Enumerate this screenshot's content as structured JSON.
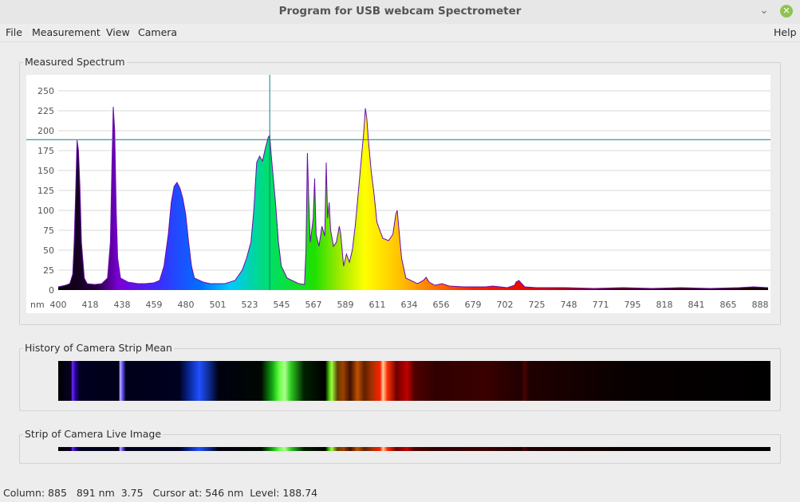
{
  "window": {
    "title": "Program for USB webcam Spectrometer"
  },
  "menu": {
    "file": "File",
    "measurement": "Measurement",
    "view": "View",
    "camera": "Camera",
    "help": "Help"
  },
  "groups": {
    "spectrum": "Measured Spectrum",
    "history": "History of Camera Strip Mean",
    "live": "Strip of Camera Live Image"
  },
  "status": {
    "column": "Column: 885",
    "nm": "891 nm",
    "value": "3.75",
    "cursor": "Cursor at: 546 nm",
    "level": "Level: 188.74"
  },
  "colors": {
    "outline": "#6a0dad",
    "cursor": "#0f7e7e",
    "grid": "#d9d9d9"
  },
  "chart_data": {
    "type": "area",
    "xlabel": "nm",
    "xlim": [
      400,
      890
    ],
    "ylim": [
      0,
      250
    ],
    "x_ticks": [
      "400",
      "418",
      "438",
      "459",
      "480",
      "501",
      "523",
      "545",
      "567",
      "589",
      "611",
      "634",
      "656",
      "679",
      "702",
      "725",
      "748",
      "771",
      "795",
      "818",
      "841",
      "865",
      "888"
    ],
    "y_ticks": [
      0,
      25,
      50,
      75,
      100,
      125,
      150,
      175,
      200,
      225,
      250
    ],
    "cursor_nm": 546,
    "level": 188.74,
    "points": [
      [
        400,
        4
      ],
      [
        405,
        6
      ],
      [
        408,
        8
      ],
      [
        410,
        20
      ],
      [
        411,
        60
      ],
      [
        412,
        120
      ],
      [
        413,
        188
      ],
      [
        414,
        175
      ],
      [
        415,
        130
      ],
      [
        416,
        60
      ],
      [
        418,
        15
      ],
      [
        420,
        8
      ],
      [
        425,
        7
      ],
      [
        430,
        8
      ],
      [
        434,
        15
      ],
      [
        436,
        60
      ],
      [
        437,
        150
      ],
      [
        438,
        230
      ],
      [
        439,
        200
      ],
      [
        440,
        100
      ],
      [
        441,
        40
      ],
      [
        443,
        15
      ],
      [
        448,
        10
      ],
      [
        455,
        8
      ],
      [
        460,
        8
      ],
      [
        466,
        9
      ],
      [
        470,
        12
      ],
      [
        473,
        30
      ],
      [
        476,
        70
      ],
      [
        478,
        110
      ],
      [
        480,
        130
      ],
      [
        482,
        135
      ],
      [
        484,
        128
      ],
      [
        486,
        115
      ],
      [
        488,
        95
      ],
      [
        490,
        60
      ],
      [
        492,
        30
      ],
      [
        494,
        15
      ],
      [
        500,
        10
      ],
      [
        505,
        8
      ],
      [
        515,
        8
      ],
      [
        522,
        12
      ],
      [
        527,
        25
      ],
      [
        530,
        40
      ],
      [
        533,
        60
      ],
      [
        535,
        100
      ],
      [
        537,
        160
      ],
      [
        539,
        168
      ],
      [
        541,
        162
      ],
      [
        543,
        178
      ],
      [
        545,
        192
      ],
      [
        546,
        194
      ],
      [
        547,
        170
      ],
      [
        548,
        150
      ],
      [
        550,
        110
      ],
      [
        552,
        60
      ],
      [
        554,
        30
      ],
      [
        558,
        15
      ],
      [
        566,
        8
      ],
      [
        570,
        7
      ],
      [
        571,
        50
      ],
      [
        572,
        172
      ],
      [
        573,
        110
      ],
      [
        574,
        60
      ],
      [
        576,
        90
      ],
      [
        577,
        140
      ],
      [
        578,
        70
      ],
      [
        580,
        55
      ],
      [
        582,
        80
      ],
      [
        584,
        68
      ],
      [
        585,
        160
      ],
      [
        586,
        90
      ],
      [
        587,
        110
      ],
      [
        588,
        75
      ],
      [
        590,
        55
      ],
      [
        592,
        60
      ],
      [
        594,
        80
      ],
      [
        595,
        70
      ],
      [
        597,
        30
      ],
      [
        599,
        45
      ],
      [
        601,
        35
      ],
      [
        603,
        50
      ],
      [
        605,
        80
      ],
      [
        606,
        100
      ],
      [
        608,
        140
      ],
      [
        610,
        180
      ],
      [
        611,
        200
      ],
      [
        612,
        228
      ],
      [
        613,
        215
      ],
      [
        614,
        190
      ],
      [
        616,
        150
      ],
      [
        618,
        120
      ],
      [
        620,
        85
      ],
      [
        624,
        65
      ],
      [
        628,
        62
      ],
      [
        631,
        70
      ],
      [
        633,
        95
      ],
      [
        634,
        100
      ],
      [
        635,
        80
      ],
      [
        637,
        40
      ],
      [
        640,
        15
      ],
      [
        648,
        8
      ],
      [
        652,
        12
      ],
      [
        654,
        16
      ],
      [
        656,
        10
      ],
      [
        660,
        6
      ],
      [
        665,
        8
      ],
      [
        670,
        5
      ],
      [
        680,
        4
      ],
      [
        695,
        4
      ],
      [
        700,
        5
      ],
      [
        710,
        3
      ],
      [
        715,
        6
      ],
      [
        716,
        10
      ],
      [
        718,
        12
      ],
      [
        720,
        8
      ],
      [
        722,
        4
      ],
      [
        730,
        3
      ],
      [
        750,
        3
      ],
      [
        770,
        2
      ],
      [
        790,
        3
      ],
      [
        810,
        2
      ],
      [
        830,
        3
      ],
      [
        850,
        2
      ],
      [
        870,
        3
      ],
      [
        880,
        4
      ],
      [
        890,
        3
      ]
    ]
  }
}
